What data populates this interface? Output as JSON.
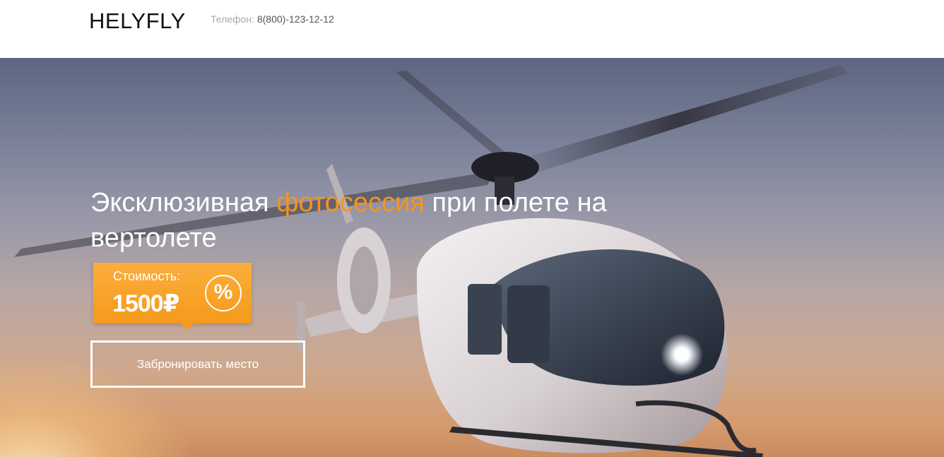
{
  "header": {
    "logo": "HELYFLY",
    "phone_label": "Телефон:",
    "phone_number": "8(800)-123-12-12"
  },
  "hero": {
    "headline_part1": "Эксклюзивная ",
    "headline_highlight": "фотосессия",
    "headline_part2": " при полете на вертолете",
    "price_label": "Стоимость:",
    "price_value": "1500₽",
    "discount_symbol": "%",
    "cta_label": "Забронировать место",
    "background_image": "helicopter-photo"
  },
  "colors": {
    "accent": "#f7941d",
    "header_bg": "#ffffff",
    "text_light": "#ffffff",
    "phone_label": "#a9a9a9"
  }
}
